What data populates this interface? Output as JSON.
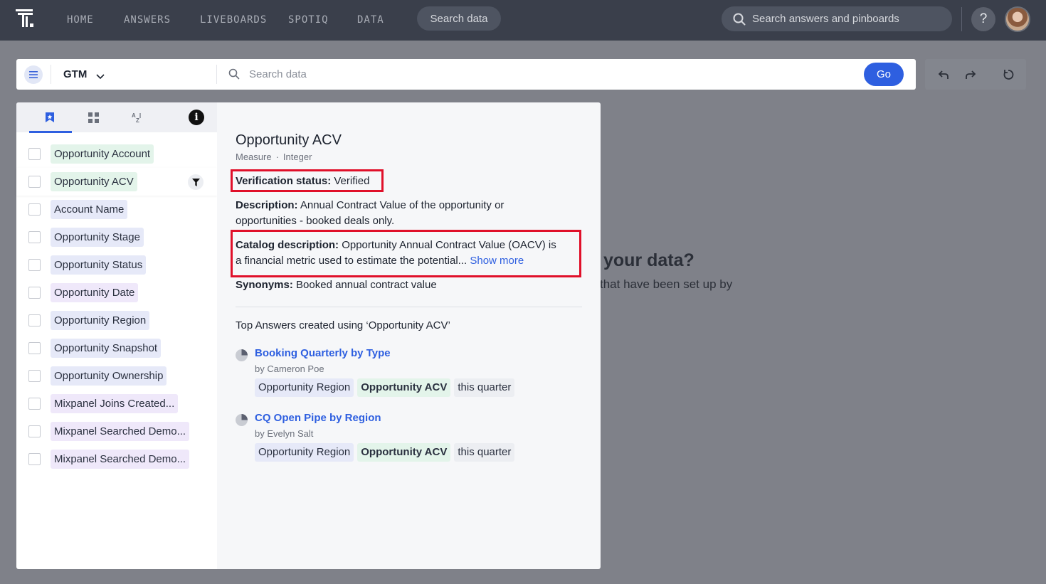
{
  "nav": {
    "links": [
      "HOME",
      "ANSWERS",
      "LIVEBOARDS",
      "SPOTIQ",
      "DATA"
    ],
    "search_data_button": "Search data",
    "global_search_placeholder": "Search answers and pinboards",
    "help_label": "?"
  },
  "searchbar": {
    "source_name": "GTM",
    "placeholder": "Search data",
    "go_label": "Go"
  },
  "columns": [
    {
      "label": "Opportunity Account",
      "kind": "measure"
    },
    {
      "label": "Opportunity ACV",
      "kind": "measure"
    },
    {
      "label": "Account Name",
      "kind": "attribute"
    },
    {
      "label": "Opportunity Stage",
      "kind": "attribute"
    },
    {
      "label": "Opportunity Status",
      "kind": "attribute"
    },
    {
      "label": "Opportunity Date",
      "kind": "mixpanel"
    },
    {
      "label": "Opportunity Region",
      "kind": "attribute"
    },
    {
      "label": "Opportunity Snapshot",
      "kind": "attribute"
    },
    {
      "label": "Opportunity Ownership",
      "kind": "attribute"
    },
    {
      "label": "Mixpanel Joins Created...",
      "kind": "mixpanel"
    },
    {
      "label": "Mixpanel Searched Demo...",
      "kind": "mixpanel"
    },
    {
      "label": "Mixpanel Searched Demo...",
      "kind": "mixpanel"
    }
  ],
  "detail": {
    "title": "Opportunity ACV",
    "type": "Measure",
    "datatype": "Integer",
    "verification_label": "Verification status:",
    "verification_value": "Verified",
    "description_label": "Description:",
    "description_line1": "Annual Contract Value of the opportunity or",
    "description_line2": "opportunities - booked deals only.",
    "catalog_label": "Catalog description:",
    "catalog_line1": "Opportunity Annual Contract Value (OACV) is",
    "catalog_line2": "a financial metric used to estimate the potential...",
    "show_more": "Show more",
    "synonyms_label": "Synonyms:",
    "synonyms_value": "Booked annual contract value",
    "top_answers_heading": "Top Answers created using ‘Opportunity ACV’",
    "answers": [
      {
        "title": "Booking Quarterly by Type",
        "author": "by Cameron Poe",
        "chips": [
          "Opportunity Region",
          "Opportunity ACV",
          "this quarter"
        ]
      },
      {
        "title": "CQ Open Pipe by Region",
        "author": "by Evelyn Salt",
        "chips": [
          "Opportunity Region",
          "Opportunity ACV",
          "this quarter"
        ]
      }
    ]
  },
  "background": {
    "heading_fragment": "your data?",
    "sub_fragment": "that have been set up by"
  },
  "colors": {
    "accent": "#2e5fe0",
    "highlight_box": "#e0102a",
    "nav_bg": "#3a3f4b",
    "overlay_bg": "#7f8189"
  }
}
